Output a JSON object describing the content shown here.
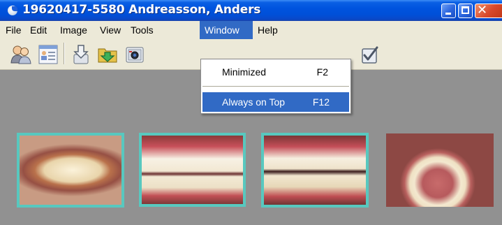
{
  "window": {
    "title": "19620417-5580 Andreasson, Anders",
    "controls": {
      "minimize": "minimize",
      "maximize": "maximize",
      "close": "close"
    }
  },
  "menubar": {
    "items": [
      {
        "label": "File"
      },
      {
        "label": "Edit"
      },
      {
        "label": "Image"
      },
      {
        "label": "View"
      },
      {
        "label": "Tools"
      },
      {
        "label": "Window",
        "active": true
      },
      {
        "label": "Help"
      }
    ]
  },
  "toolbar": {
    "buttons": [
      {
        "icon": "patients-icon"
      },
      {
        "icon": "patient-card-icon"
      },
      {
        "icon": "import-icon"
      },
      {
        "icon": "open-folder-icon"
      },
      {
        "icon": "camera-icon"
      },
      {
        "icon": "check-icon"
      }
    ]
  },
  "window_menu": {
    "items": [
      {
        "label": "Minimized",
        "shortcut": "F2",
        "highlighted": false
      },
      {
        "label": "Always on Top",
        "shortcut": "F12",
        "highlighted": true
      }
    ]
  },
  "gallery": {
    "thumbnails": [
      {
        "subject": "smile-front-view",
        "selected": true
      },
      {
        "subject": "teeth-front-view",
        "selected": true
      },
      {
        "subject": "teeth-front-view-open",
        "selected": true
      },
      {
        "subject": "upper-arch-occlusal-view",
        "selected": false
      }
    ]
  },
  "colors": {
    "titlebar": "#0053de",
    "menu_highlight": "#316ac5",
    "selection_border": "#58c8bf",
    "canvas": "#919191",
    "chrome": "#ece9d8"
  }
}
